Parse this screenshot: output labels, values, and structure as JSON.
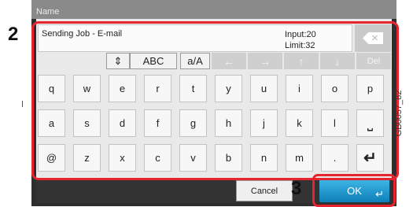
{
  "name_label": "Name",
  "input_text": "Sending Job - E-mail",
  "input_count": "Input:20",
  "limit_count": "Limit:32",
  "backspace_icon": "backspace-icon",
  "mode_buttons": {
    "cycle_glyph": "⇕",
    "abc": "ABC",
    "case": "a/A"
  },
  "cursor_buttons": {
    "left": "←",
    "right": "→",
    "up": "↑",
    "down": "↓",
    "del": "Del"
  },
  "keys_row1": [
    "q",
    "w",
    "e",
    "r",
    "t",
    "y",
    "u",
    "i",
    "o",
    "p"
  ],
  "keys_row2": [
    "a",
    "s",
    "d",
    "f",
    "g",
    "h",
    "j",
    "k",
    "l"
  ],
  "keys_row3": [
    "@",
    "z",
    "x",
    "c",
    "v",
    "b",
    "n",
    "m",
    "."
  ],
  "space_glyph": "⎵",
  "enter_glyph": "↵",
  "cancel_label": "Cancel",
  "ok_label": "OK",
  "ok_glyph": "↵",
  "step_labels": {
    "two": "2",
    "three": "3"
  },
  "figure_code": "GB0057_82",
  "highlight_color": "#e6242e",
  "ok_color": "#1a9ad6"
}
